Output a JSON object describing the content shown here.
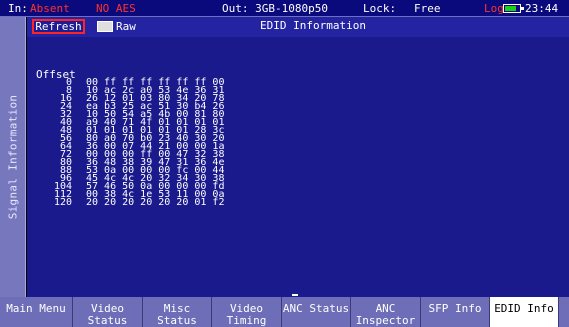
{
  "status": {
    "in_label": "In:",
    "in_value": "Absent",
    "no_aes": "NO AES",
    "out_label": "Out: 3GB-1080p50",
    "lock_label": "Lock:",
    "lock_value": "Free",
    "log_label": "Log",
    "time": "23:44",
    "colors": {
      "alert": "#ff3030",
      "bar": "#0a0a7c",
      "battery": "#19d219"
    }
  },
  "side_tab": {
    "label": "Signal Information"
  },
  "panel": {
    "refresh_label": "Refresh",
    "raw_label": "Raw",
    "title": "EDID Information",
    "offset_header": "Offset",
    "rows": [
      {
        "offset": "0",
        "bytes": "00 ff ff ff ff ff ff 00"
      },
      {
        "offset": "8",
        "bytes": "10 ac 2c a0 53 4e 36 31"
      },
      {
        "offset": "16",
        "bytes": "26 12 01 03 80 34 20 78"
      },
      {
        "offset": "24",
        "bytes": "ea b3 25 ac 51 30 b4 26"
      },
      {
        "offset": "32",
        "bytes": "10 50 54 a5 4b 00 81 80"
      },
      {
        "offset": "40",
        "bytes": "a9 40 71 4f 01 01 01 01"
      },
      {
        "offset": "48",
        "bytes": "01 01 01 01 01 01 28 3c"
      },
      {
        "offset": "56",
        "bytes": "80 a0 70 b0 23 40 30 20"
      },
      {
        "offset": "64",
        "bytes": "36 00 07 44 21 00 00 1a"
      },
      {
        "offset": "72",
        "bytes": "00 00 00 ff 00 47 32 38"
      },
      {
        "offset": "80",
        "bytes": "36 48 38 39 47 31 36 4e"
      },
      {
        "offset": "88",
        "bytes": "53 0a 00 00 00 fc 00 44"
      },
      {
        "offset": "96",
        "bytes": "45 4c 4c 20 32 34 30 38"
      },
      {
        "offset": "104",
        "bytes": "57 46 50 0a 00 00 00 fd"
      },
      {
        "offset": "112",
        "bytes": "00 38 4c 1e 53 11 00 0a"
      },
      {
        "offset": "120",
        "bytes": "20 20 20 20 20 20 01 f2"
      }
    ]
  },
  "menu": {
    "items": [
      {
        "label": "Main Menu",
        "active": false
      },
      {
        "label": "Video Status",
        "active": false
      },
      {
        "label": "Misc Status",
        "active": false
      },
      {
        "label": "Video Timing",
        "active": false
      },
      {
        "label": "ANC Status",
        "active": false
      },
      {
        "label": "ANC Inspector",
        "active": false
      },
      {
        "label": "SFP Info",
        "active": false
      },
      {
        "label": "EDID Info",
        "active": true
      }
    ]
  }
}
